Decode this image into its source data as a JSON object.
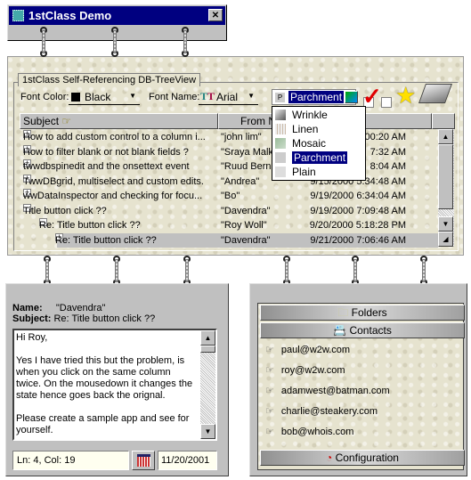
{
  "window": {
    "title": "1stClass Demo",
    "close_label": "✕"
  },
  "tree": {
    "group_label": "1stClass Self-Referencing DB-TreeView",
    "font_color_label": "Font Color:",
    "font_color_value": "Black",
    "font_name_label": "Font Name:",
    "font_name_value": "Arial",
    "texture_value": "Parchment",
    "texture_options": [
      {
        "label": "Wrinkle"
      },
      {
        "label": "Linen"
      },
      {
        "label": "Mosaic"
      },
      {
        "label": "Parchment",
        "selected": true
      },
      {
        "label": "Plain"
      }
    ],
    "columns": [
      "Subject",
      "From Na",
      ""
    ],
    "rows": [
      {
        "subject": "How to add custom control to a column i...",
        "from": "\"john lim\"",
        "date": "00:20 AM",
        "exp": "+",
        "level": 0
      },
      {
        "subject": "How to filter blank or not blank fields ?",
        "from": "\"Sraya Malki",
        "date": "7:32 AM",
        "exp": "+",
        "level": 0
      },
      {
        "subject": "twwdbspinedit and the onsettext event",
        "from": "\"Ruud Berna",
        "date": "8:04 AM",
        "exp": "+",
        "level": 0
      },
      {
        "subject": "TwwDBgrid, multiselect and custom edits.",
        "from": "\"Andrea\"",
        "date": "9/15/2000 5:34:48 AM",
        "exp": "+",
        "level": 0
      },
      {
        "subject": "wwDataInspector and checking for focu...",
        "from": "\"Bo\"",
        "date": "9/19/2000 6:34:04 AM",
        "exp": "+",
        "level": 0
      },
      {
        "subject": "Title button click ??",
        "from": "\"Davendra\"",
        "date": "9/19/2000 7:09:48 AM",
        "exp": "−",
        "level": 0
      },
      {
        "subject": "Re: Title button click ??",
        "from": "\"Roy Woll\"",
        "date": "9/20/2000 5:18:28 PM",
        "exp": "−",
        "level": 1
      },
      {
        "subject": "Re: Title button click ??",
        "from": "\"Davendra\"",
        "date": "9/21/2000 7:06:46 AM",
        "exp": "+",
        "level": 2,
        "selected": true
      }
    ]
  },
  "message": {
    "name_label": "Name:",
    "name_value": "\"Davendra\"",
    "subject_label": "Subject:",
    "subject_value": "Re: Title button click ??",
    "body": "Hi Roy,\n\nYes I have tried this but the problem, is when you click on the same column\ntwice. On the mousedown it changes the state hence goes back the orignal.\n\nPlease create a sample app and see for yourself.",
    "status": "Ln: 4, Col: 19",
    "date": "11/20/2001"
  },
  "nav": {
    "folders_label": "Folders",
    "contacts_label": "Contacts",
    "configuration_label": "Configuration",
    "contacts": [
      "paul@w2w.com",
      "roy@w2w.com",
      "adamwest@batman.com",
      "charlie@steakery.com",
      "bob@whois.com"
    ]
  },
  "colors": {
    "titlebar": "#000080",
    "selection": "#000080",
    "parchment": "#e6e3cf"
  }
}
